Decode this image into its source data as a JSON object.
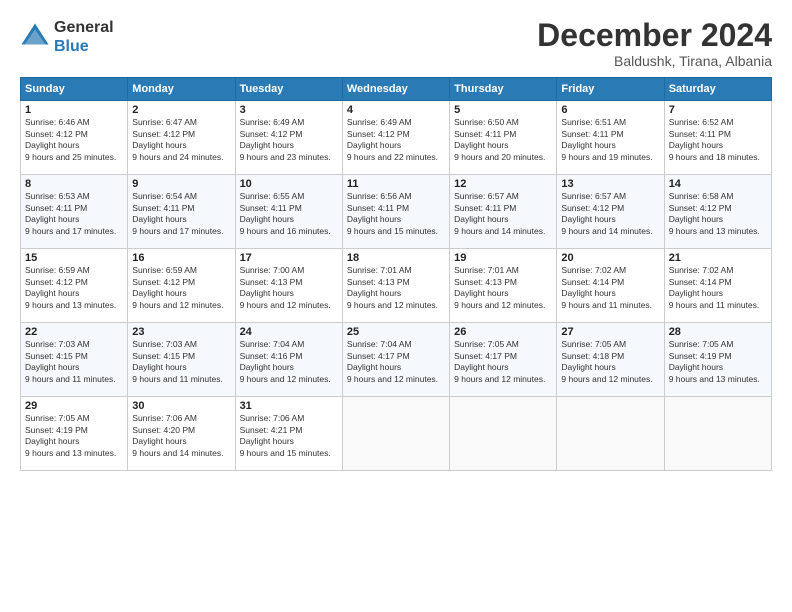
{
  "logo": {
    "general": "General",
    "blue": "Blue"
  },
  "header": {
    "title": "December 2024",
    "subtitle": "Baldushk, Tirana, Albania"
  },
  "days_of_week": [
    "Sunday",
    "Monday",
    "Tuesday",
    "Wednesday",
    "Thursday",
    "Friday",
    "Saturday"
  ],
  "weeks": [
    [
      {
        "day": 1,
        "sunrise": "6:46 AM",
        "sunset": "4:12 PM",
        "daylight": "9 hours and 25 minutes."
      },
      {
        "day": 2,
        "sunrise": "6:47 AM",
        "sunset": "4:12 PM",
        "daylight": "9 hours and 24 minutes."
      },
      {
        "day": 3,
        "sunrise": "6:49 AM",
        "sunset": "4:12 PM",
        "daylight": "9 hours and 23 minutes."
      },
      {
        "day": 4,
        "sunrise": "6:49 AM",
        "sunset": "4:12 PM",
        "daylight": "9 hours and 22 minutes."
      },
      {
        "day": 5,
        "sunrise": "6:50 AM",
        "sunset": "4:11 PM",
        "daylight": "9 hours and 20 minutes."
      },
      {
        "day": 6,
        "sunrise": "6:51 AM",
        "sunset": "4:11 PM",
        "daylight": "9 hours and 19 minutes."
      },
      {
        "day": 7,
        "sunrise": "6:52 AM",
        "sunset": "4:11 PM",
        "daylight": "9 hours and 18 minutes."
      }
    ],
    [
      {
        "day": 8,
        "sunrise": "6:53 AM",
        "sunset": "4:11 PM",
        "daylight": "9 hours and 17 minutes."
      },
      {
        "day": 9,
        "sunrise": "6:54 AM",
        "sunset": "4:11 PM",
        "daylight": "9 hours and 17 minutes."
      },
      {
        "day": 10,
        "sunrise": "6:55 AM",
        "sunset": "4:11 PM",
        "daylight": "9 hours and 16 minutes."
      },
      {
        "day": 11,
        "sunrise": "6:56 AM",
        "sunset": "4:11 PM",
        "daylight": "9 hours and 15 minutes."
      },
      {
        "day": 12,
        "sunrise": "6:57 AM",
        "sunset": "4:11 PM",
        "daylight": "9 hours and 14 minutes."
      },
      {
        "day": 13,
        "sunrise": "6:57 AM",
        "sunset": "4:12 PM",
        "daylight": "9 hours and 14 minutes."
      },
      {
        "day": 14,
        "sunrise": "6:58 AM",
        "sunset": "4:12 PM",
        "daylight": "9 hours and 13 minutes."
      }
    ],
    [
      {
        "day": 15,
        "sunrise": "6:59 AM",
        "sunset": "4:12 PM",
        "daylight": "9 hours and 13 minutes."
      },
      {
        "day": 16,
        "sunrise": "6:59 AM",
        "sunset": "4:12 PM",
        "daylight": "9 hours and 12 minutes."
      },
      {
        "day": 17,
        "sunrise": "7:00 AM",
        "sunset": "4:13 PM",
        "daylight": "9 hours and 12 minutes."
      },
      {
        "day": 18,
        "sunrise": "7:01 AM",
        "sunset": "4:13 PM",
        "daylight": "9 hours and 12 minutes."
      },
      {
        "day": 19,
        "sunrise": "7:01 AM",
        "sunset": "4:13 PM",
        "daylight": "9 hours and 12 minutes."
      },
      {
        "day": 20,
        "sunrise": "7:02 AM",
        "sunset": "4:14 PM",
        "daylight": "9 hours and 11 minutes."
      },
      {
        "day": 21,
        "sunrise": "7:02 AM",
        "sunset": "4:14 PM",
        "daylight": "9 hours and 11 minutes."
      }
    ],
    [
      {
        "day": 22,
        "sunrise": "7:03 AM",
        "sunset": "4:15 PM",
        "daylight": "9 hours and 11 minutes."
      },
      {
        "day": 23,
        "sunrise": "7:03 AM",
        "sunset": "4:15 PM",
        "daylight": "9 hours and 11 minutes."
      },
      {
        "day": 24,
        "sunrise": "7:04 AM",
        "sunset": "4:16 PM",
        "daylight": "9 hours and 12 minutes."
      },
      {
        "day": 25,
        "sunrise": "7:04 AM",
        "sunset": "4:17 PM",
        "daylight": "9 hours and 12 minutes."
      },
      {
        "day": 26,
        "sunrise": "7:05 AM",
        "sunset": "4:17 PM",
        "daylight": "9 hours and 12 minutes."
      },
      {
        "day": 27,
        "sunrise": "7:05 AM",
        "sunset": "4:18 PM",
        "daylight": "9 hours and 12 minutes."
      },
      {
        "day": 28,
        "sunrise": "7:05 AM",
        "sunset": "4:19 PM",
        "daylight": "9 hours and 13 minutes."
      }
    ],
    [
      {
        "day": 29,
        "sunrise": "7:05 AM",
        "sunset": "4:19 PM",
        "daylight": "9 hours and 13 minutes."
      },
      {
        "day": 30,
        "sunrise": "7:06 AM",
        "sunset": "4:20 PM",
        "daylight": "9 hours and 14 minutes."
      },
      {
        "day": 31,
        "sunrise": "7:06 AM",
        "sunset": "4:21 PM",
        "daylight": "9 hours and 15 minutes."
      },
      null,
      null,
      null,
      null
    ]
  ]
}
